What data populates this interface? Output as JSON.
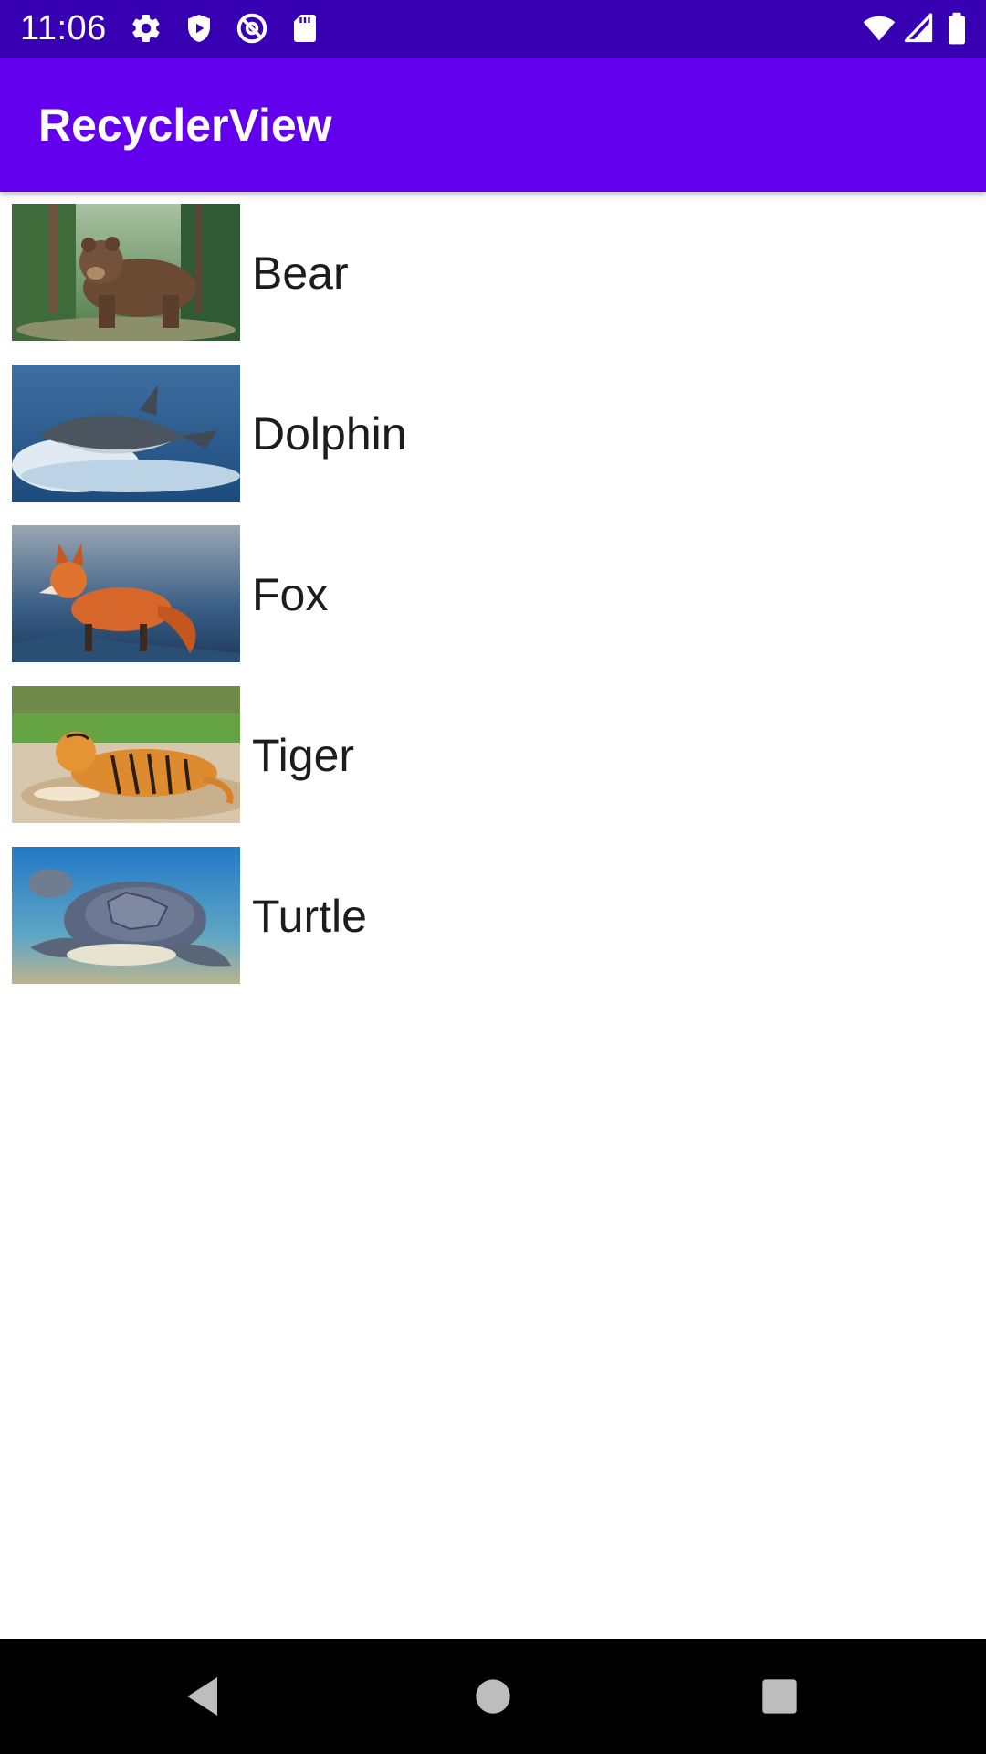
{
  "status_bar": {
    "time": "11:06",
    "left_icons": [
      "gear-icon",
      "shield-icon",
      "at-sign-icon",
      "sd-card-icon"
    ],
    "right_icons": [
      "wifi-icon",
      "signal-icon",
      "battery-icon"
    ],
    "background": "#3700b3"
  },
  "app_bar": {
    "title": "RecyclerView",
    "background": "#6200ee"
  },
  "list": {
    "items": [
      {
        "label": "Bear",
        "image": "bear-photo"
      },
      {
        "label": "Dolphin",
        "image": "dolphin-photo"
      },
      {
        "label": "Fox",
        "image": "fox-photo"
      },
      {
        "label": "Tiger",
        "image": "tiger-photo"
      },
      {
        "label": "Turtle",
        "image": "turtle-photo"
      }
    ]
  },
  "nav_bar": {
    "buttons": [
      "back-icon",
      "home-icon",
      "recents-icon"
    ],
    "background": "#000000"
  }
}
